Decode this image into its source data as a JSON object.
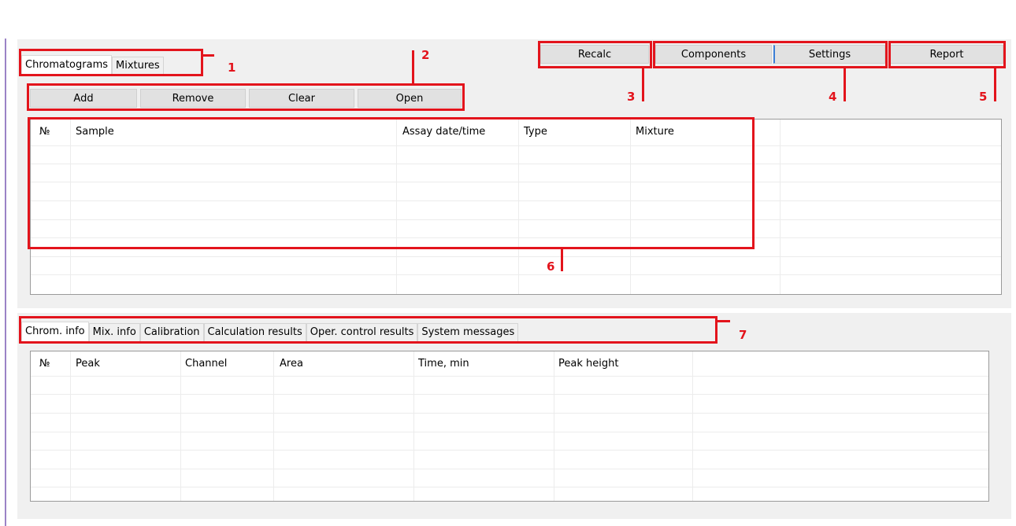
{
  "top_tabs": [
    {
      "label": "Chromatograms",
      "active": true
    },
    {
      "label": "Mixtures",
      "active": false
    }
  ],
  "chrom_buttons": {
    "add": "Add",
    "remove": "Remove",
    "clear": "Clear",
    "open": "Open"
  },
  "toolbar": {
    "recalc": "Recalc",
    "components": "Components",
    "settings": "Settings",
    "report": "Report"
  },
  "chromatograms_table": {
    "columns": [
      "№",
      "Sample",
      "Assay date/time",
      "Type",
      "Mixture"
    ],
    "rows": []
  },
  "bottom_tabs": [
    {
      "label": "Chrom. info",
      "active": true
    },
    {
      "label": "Mix. info",
      "active": false
    },
    {
      "label": "Calibration",
      "active": false
    },
    {
      "label": "Calculation results",
      "active": false
    },
    {
      "label": "Oper. control results",
      "active": false
    },
    {
      "label": "System messages",
      "active": false
    }
  ],
  "peaks_table": {
    "columns": [
      "№",
      "Peak",
      "Channel",
      "Area",
      "Time, min",
      "Peak height"
    ],
    "rows": []
  },
  "annotations": [
    "1",
    "2",
    "3",
    "4",
    "5",
    "6",
    "7"
  ],
  "colors": {
    "annotation": "#e3141c",
    "focus_accent": "#3c7fd6",
    "panel": "#f0f0f0"
  }
}
